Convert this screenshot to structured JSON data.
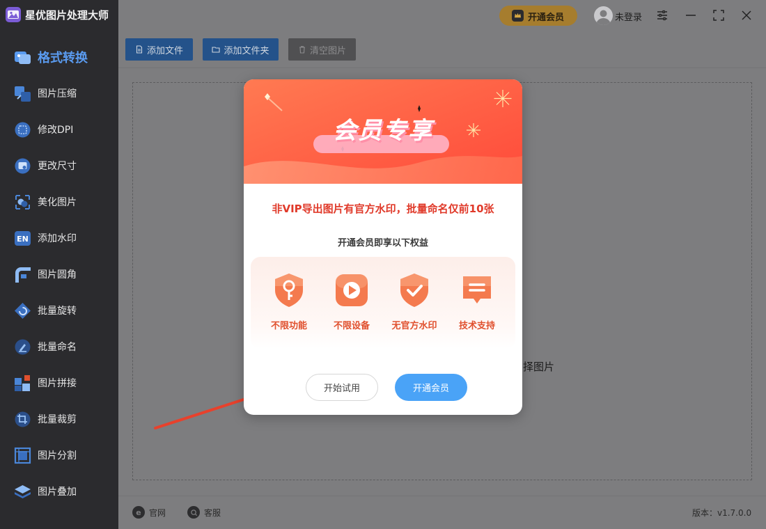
{
  "app": {
    "title": "星优图片处理大师"
  },
  "sidebar": {
    "items": [
      {
        "label": "格式转换",
        "icon": "format-convert-icon",
        "active": true
      },
      {
        "label": "图片压缩",
        "icon": "compress-icon"
      },
      {
        "label": "修改DPI",
        "icon": "dpi-icon"
      },
      {
        "label": "更改尺寸",
        "icon": "resize-icon"
      },
      {
        "label": "美化图片",
        "icon": "beautify-icon"
      },
      {
        "label": "添加水印",
        "icon": "watermark-icon"
      },
      {
        "label": "图片圆角",
        "icon": "rounded-corner-icon"
      },
      {
        "label": "批量旋转",
        "icon": "rotate-icon"
      },
      {
        "label": "批量命名",
        "icon": "rename-icon"
      },
      {
        "label": "图片拼接",
        "icon": "stitch-icon"
      },
      {
        "label": "批量裁剪",
        "icon": "crop-icon"
      },
      {
        "label": "图片分割",
        "icon": "split-icon"
      },
      {
        "label": "图片叠加",
        "icon": "overlay-icon"
      }
    ]
  },
  "topbar": {
    "vip_label": "开通会员",
    "login_label": "未登录"
  },
  "toolbar": {
    "add_file": "添加文件",
    "add_folder": "添加文件夹",
    "clear_images": "清空图片"
  },
  "drop_area": {
    "hint": "择图片"
  },
  "footer": {
    "website": "官网",
    "support": "客服",
    "version": "版本：v1.7.0.0"
  },
  "modal": {
    "banner_title": "会员专享",
    "notice": "非VIP导出图片有官方水印，批量命名仅前10张",
    "subtitle": "开通会员即享以下权益",
    "benefits": [
      {
        "label": "不限功能",
        "icon": "key-shield-icon"
      },
      {
        "label": "不限设备",
        "icon": "play-device-icon"
      },
      {
        "label": "无官方水印",
        "icon": "check-shield-icon"
      },
      {
        "label": "技术支持",
        "icon": "chat-support-icon"
      }
    ],
    "trial_button": "开始试用",
    "open_vip_button": "开通会员"
  },
  "colors": {
    "sidebar_bg": "#2b2b2e",
    "accent_blue": "#4aa3f7",
    "active_nav": "#5a9bf0",
    "notice_red": "#e03a2a",
    "banner_orange": "#ff5a3c",
    "vip_gold": "#a67d2e"
  }
}
